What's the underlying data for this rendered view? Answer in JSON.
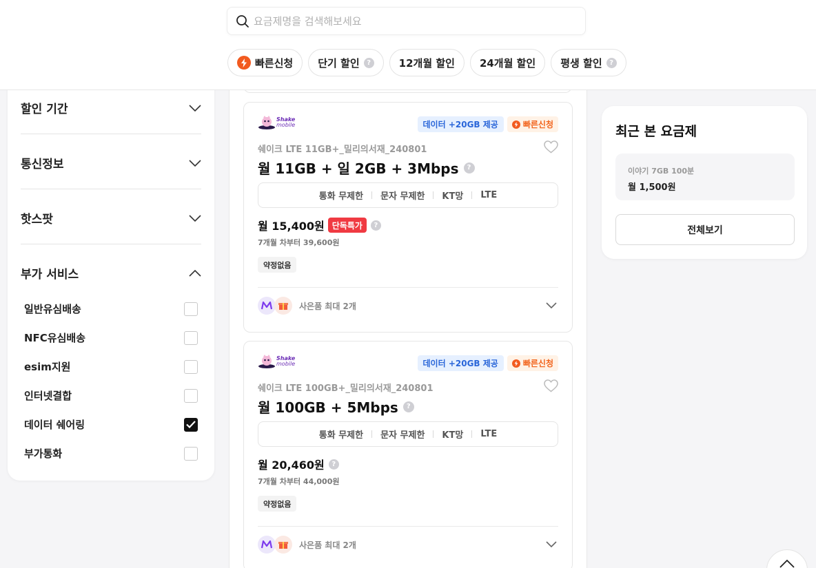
{
  "search": {
    "placeholder": "요금제명을 검색해보세요"
  },
  "chips": [
    {
      "label": "빠른신청",
      "icon": "lightning-icon"
    },
    {
      "label": "단기 할인",
      "help": "?"
    },
    {
      "label": "12개월 할인"
    },
    {
      "label": "24개월 할인"
    },
    {
      "label": "평생 할인",
      "help": "?"
    }
  ],
  "filters": {
    "sections": [
      {
        "label": "할인 기간",
        "expanded": false
      },
      {
        "label": "통신정보",
        "expanded": false
      },
      {
        "label": "핫스팟",
        "expanded": false
      },
      {
        "label": "부가 서비스",
        "expanded": true
      }
    ],
    "options": [
      {
        "label": "일반유심배송",
        "checked": false
      },
      {
        "label": "NFC유심배송",
        "checked": false
      },
      {
        "label": "esim지원",
        "checked": false
      },
      {
        "label": "인터넷결합",
        "checked": false
      },
      {
        "label": "데이터 쉐어링",
        "checked": true
      },
      {
        "label": "부가통화",
        "checked": false
      }
    ]
  },
  "plans": [
    {
      "logo_text": [
        "Shake",
        "mobile"
      ],
      "badge_data": "데이터 +20GB 제공",
      "badge_quick": "빠른신청",
      "name": "쉐이크 LTE 11GB+_밀리의서재_240801",
      "title": "월 11GB + 일 2GB + 3Mbps",
      "specs": [
        "통화 무제한",
        "문자 무제한",
        "KT망",
        "LTE"
      ],
      "price": "월 15,400원",
      "special": "단독특가",
      "after": "7개월 차부터 39,600원",
      "contract": "약정없음",
      "gift": "사은품 최대 2개"
    },
    {
      "logo_text": [
        "Shake",
        "mobile"
      ],
      "badge_data": "데이터 +20GB 제공",
      "badge_quick": "빠른신청",
      "name": "쉐이크 LTE 100GB+_밀리의서재_240801",
      "title": "월 100GB + 5Mbps",
      "specs": [
        "통화 무제한",
        "문자 무제한",
        "KT망",
        "LTE"
      ],
      "price": "월 20,460원",
      "after": "7개월 차부터 44,000원",
      "contract": "약정없음",
      "gift": "사은품 최대 2개"
    }
  ],
  "recent": {
    "title": "최근 본 요금제",
    "item_name": "이야기 7GB 100분",
    "item_price": "월 1,500원",
    "view_all": "전체보기"
  },
  "colors": {
    "accent_orange": "#f25a1f",
    "special_red": "#f03a42",
    "data_blue": "#2a66d9"
  }
}
